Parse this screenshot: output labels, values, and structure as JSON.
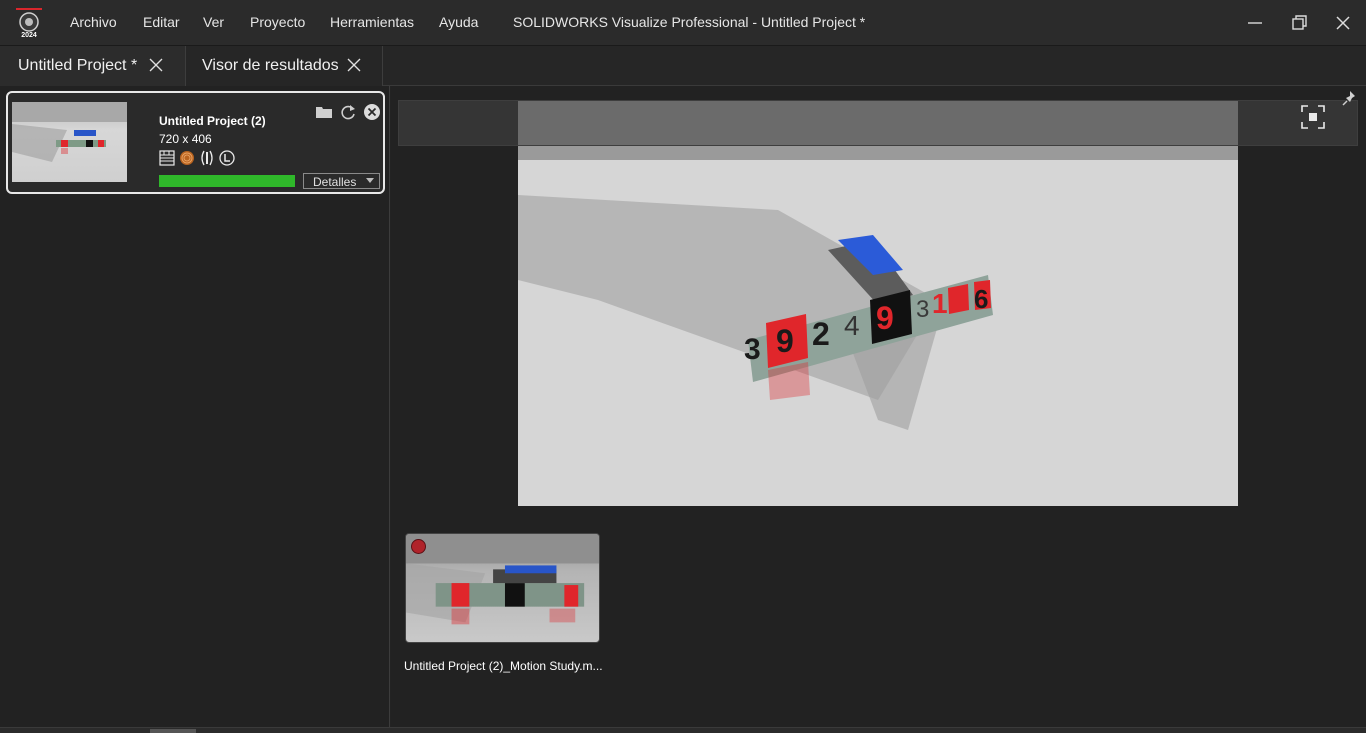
{
  "app": {
    "logo_icon": "solidworks-visualize-logo-icon",
    "logo_year": "2024",
    "title": "SOLIDWORKS Visualize Professional - Untitled Project *"
  },
  "menu": {
    "items": [
      "Archivo",
      "Editar",
      "Ver",
      "Proyecto",
      "Herramientas",
      "Ayuda"
    ]
  },
  "window_controls": {
    "minimize_icon": "minimize-icon",
    "restore_icon": "restore-icon",
    "close_icon": "close-icon"
  },
  "tabs": [
    {
      "label": "Untitled Project *",
      "active": false
    },
    {
      "label": "Visor de resultados",
      "active": true
    }
  ],
  "job_queue": {
    "items": [
      {
        "title": "Untitled Project (2)",
        "resolution": "720 x 406",
        "progress": 1.0,
        "details_label": "Detalles",
        "icons": [
          "film-strip-icon",
          "render-target-icon",
          "denoiser-icon",
          "license-icon"
        ],
        "actions": [
          "open-folder-icon",
          "refresh-icon",
          "remove-icon"
        ]
      }
    ]
  },
  "viewer": {
    "pin_icon": "pin-icon",
    "fit_icon": "fit-to-view-icon",
    "preview_digits": [
      "3",
      "9",
      "2",
      "4",
      "9",
      "3",
      "1",
      "6"
    ]
  },
  "results": {
    "items": [
      {
        "label": "Untitled Project (2)_Motion Study.m...",
        "status_color": "#b0232a"
      }
    ]
  },
  "colors": {
    "accent_red": "#e0262b",
    "progress_green": "#2fb82a",
    "background": "#232323"
  }
}
